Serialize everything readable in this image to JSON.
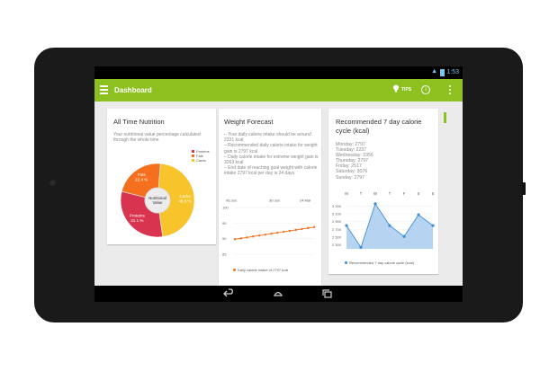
{
  "statusbar": {
    "time": "1:53"
  },
  "actionbar": {
    "title": "Dashboard",
    "tips_label": "TIPS"
  },
  "nutrition": {
    "title": "All Time Nutrition",
    "description": "Your nutritional value percentage calculated through the whole time",
    "center_label": "Nutritional Value",
    "legend": [
      {
        "name": "Proteins",
        "color": "#d9344f"
      },
      {
        "name": "Fats",
        "color": "#f4701f"
      },
      {
        "name": "Carbs",
        "color": "#f7c42b"
      }
    ],
    "slices": [
      {
        "name": "Carbs",
        "value": 46.5,
        "label": "Carbs\n46.5 %",
        "color": "#f7c42b"
      },
      {
        "name": "Proteins",
        "value": 31.1,
        "label": "Proteins\n31.1 %",
        "color": "#d9344f"
      },
      {
        "name": "Fats",
        "value": 22.4,
        "label": "Fats\n22.4 %",
        "color": "#f4701f"
      }
    ]
  },
  "forecast": {
    "title": "Weight Forecast",
    "lines": [
      "– Your daily calorie intake should be around 2331 kcal",
      "– Recommended daily calorie intake for weight gain is 2797 kcal",
      "– Daily calorie intake for extreme weight gain is 3263 kcal",
      "– End date of reaching goal weight with calorie intake 2797 kcal per day is 24 days"
    ],
    "dates": [
      "06 Jan",
      "30 Jan",
      "24 Mar"
    ],
    "y_ticks": [
      "100",
      "95",
      "90",
      "85"
    ],
    "legend": "Daily calorie intake of 2797 kcal",
    "color": "#f4701f"
  },
  "weekly": {
    "title": "Recommended 7 day calorie cycle (kcal)",
    "days": [
      {
        "label": "Monday: 2797"
      },
      {
        "label": "Tuesday: 2237"
      },
      {
        "label": "Wednesday: 3356"
      },
      {
        "label": "Thursday: 2797"
      },
      {
        "label": "Friday: 2517"
      },
      {
        "label": "Saturday: 3076"
      },
      {
        "label": "Sunday: 2797"
      }
    ],
    "legend": "Recommended 7 day calorie cycle (kcal)",
    "color": "#3d8fd6"
  },
  "chart_data": [
    {
      "type": "pie",
      "title": "",
      "categories": [
        "Carbs",
        "Proteins",
        "Fats"
      ],
      "values": [
        46.5,
        31.1,
        22.4
      ]
    },
    {
      "type": "line",
      "title": "",
      "series": [
        {
          "name": "Daily calorie intake of 2797 kcal",
          "values": [
            89.8,
            90.1,
            90.4,
            90.7,
            91.0,
            91.3,
            91.6,
            91.9,
            92.2,
            92.5,
            92.8,
            93.1,
            93.4,
            93.7
          ]
        }
      ],
      "x": [
        "06 Jan",
        "30 Jan",
        "24 Mar"
      ],
      "ylim": [
        85,
        100
      ]
    },
    {
      "type": "area",
      "title": "",
      "categories": [
        "M",
        "T",
        "W",
        "T",
        "F",
        "S",
        "S"
      ],
      "series": [
        {
          "name": "Recommended 7 day calorie cycle (kcal)",
          "values": [
            2797,
            2237,
            3356,
            2797,
            2517,
            3076,
            2797
          ]
        }
      ],
      "y_ticks": [
        "3 300",
        "3 100",
        "2 900",
        "2 700",
        "2 500",
        "2 300"
      ],
      "ylim": [
        2200,
        3400
      ]
    }
  ]
}
